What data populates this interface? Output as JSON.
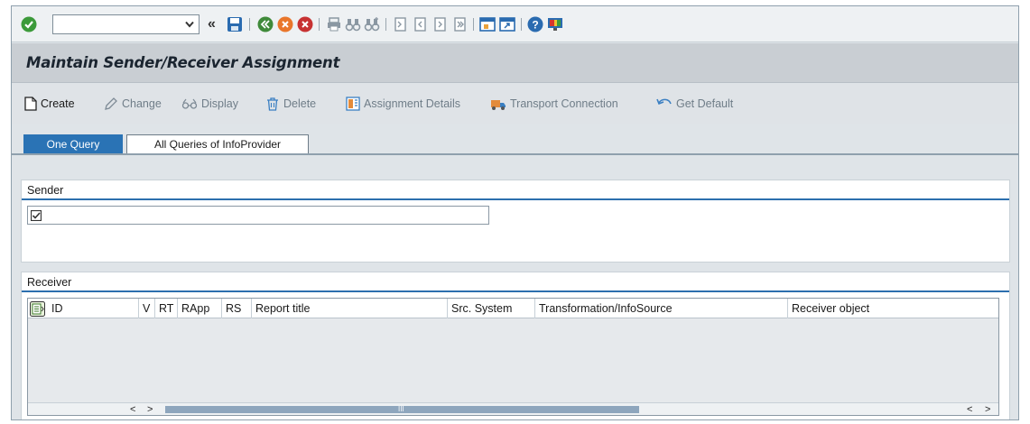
{
  "system_toolbar": {
    "command_field": {
      "value": "",
      "placeholder": ""
    },
    "back_arrows": "«"
  },
  "title": "Maintain Sender/Receiver Assignment",
  "app_toolbar": [
    {
      "label": "Create",
      "icon": "document-icon",
      "enabled": true
    },
    {
      "label": "Change",
      "icon": "pencil-icon",
      "enabled": false
    },
    {
      "label": "Display",
      "icon": "glasses-icon",
      "enabled": false
    },
    {
      "label": "Delete",
      "icon": "trash-icon",
      "enabled": false
    },
    {
      "label": "Assignment Details",
      "icon": "details-icon",
      "enabled": false
    },
    {
      "label": "Transport Connection",
      "icon": "truck-icon",
      "enabled": false
    },
    {
      "label": "Get Default",
      "icon": "undo-icon",
      "enabled": false
    }
  ],
  "tabs": [
    {
      "label": "One Query",
      "active": true
    },
    {
      "label": "All Queries of InfoProvider",
      "active": false
    }
  ],
  "sender": {
    "group_title": "Sender",
    "field_value": ""
  },
  "receiver": {
    "group_title": "Receiver",
    "columns": [
      "ID",
      "V",
      "RT",
      "RApp",
      "RS",
      "Report title",
      "Src. System",
      "Transformation/InfoSource",
      "Receiver object"
    ],
    "rows": [],
    "scroll_left": "<",
    "scroll_right": ">",
    "thumb_grip": "III"
  },
  "colors": {
    "accent_blue": "#2a73b5",
    "ok_green": "#3c9a3a",
    "title_bg": "#c9ced3"
  }
}
